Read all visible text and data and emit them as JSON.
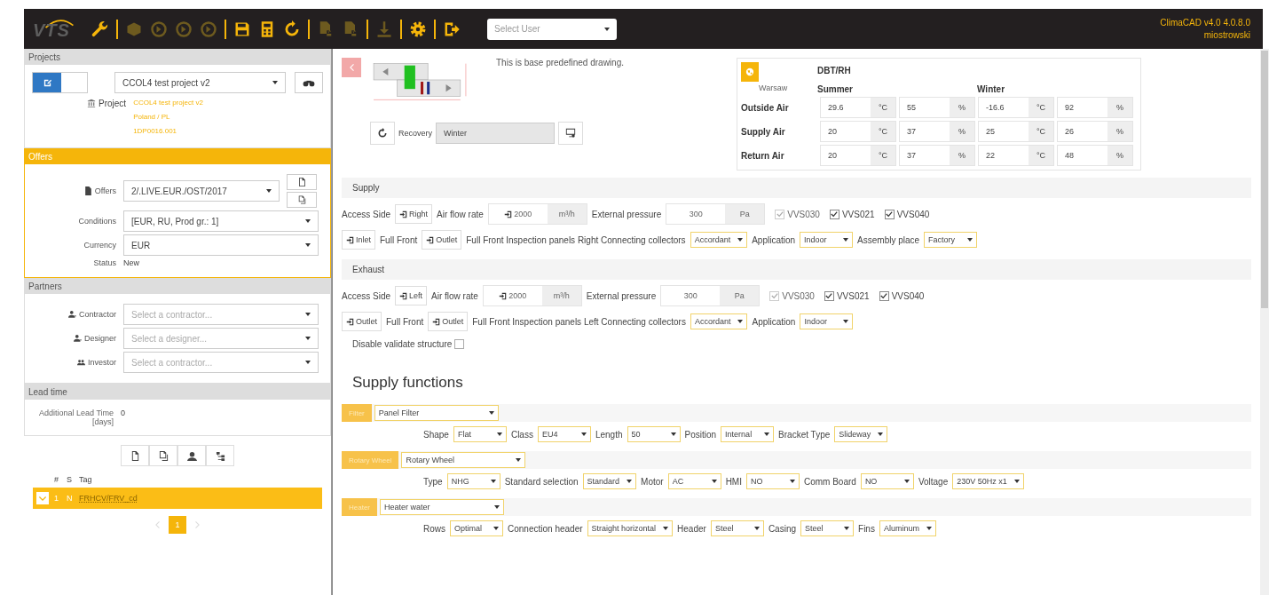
{
  "topbar": {
    "logo": "VTS",
    "toolbar": [
      [
        {
          "kind": "wrench",
          "disabled": false
        }
      ],
      [
        {
          "kind": "cube",
          "disabled": true
        },
        {
          "kind": "circle-arrow",
          "disabled": true
        },
        {
          "kind": "circle-arrow",
          "disabled": true
        },
        {
          "kind": "circle-arrow",
          "disabled": true
        }
      ],
      [
        {
          "kind": "save",
          "disabled": false
        },
        {
          "kind": "calculator",
          "disabled": false
        },
        {
          "kind": "refresh",
          "disabled": false
        }
      ],
      [
        {
          "kind": "document",
          "disabled": true
        },
        {
          "kind": "document",
          "disabled": true
        }
      ],
      [
        {
          "kind": "download",
          "disabled": true
        }
      ],
      [
        {
          "kind": "gear",
          "disabled": false
        }
      ],
      [
        {
          "kind": "logout",
          "disabled": false
        }
      ]
    ],
    "user_select": {
      "placeholder": "Select User"
    },
    "app_version": "ClimaCAD v4.0 4.0.8.0",
    "username": "miostrowski"
  },
  "sidebar": {
    "projects": {
      "header": "Projects",
      "selected": false,
      "edit_on": true,
      "project": "CCOL4 test project v2",
      "info_label": "Project",
      "info_lines": [
        "CCOL4 test project v2",
        "Poland / PL",
        "1DP0016.001"
      ]
    },
    "offers": {
      "header": "Offers",
      "selected": true,
      "offer_label": "Offers",
      "offer": "2/.LIVE.EUR./OST/2017",
      "conditions_label": "Conditions",
      "conditions": "[EUR, RU, Prod gr.: 1]",
      "currency_label": "Currency",
      "currency": "EUR",
      "status_label": "Status",
      "status": "New"
    },
    "partners": {
      "header": "Partners",
      "selected": false,
      "fields": [
        {
          "kind": "person",
          "label": "Contractor",
          "placeholder": "Select a contractor..."
        },
        {
          "kind": "person",
          "label": "Designer",
          "placeholder": "Select a designer..."
        },
        {
          "kind": "group",
          "label": "Investor",
          "placeholder": "Select a contractor..."
        }
      ]
    },
    "lead_time": {
      "header": "Lead time",
      "selected": false,
      "label": "Additional Lead Time",
      "unit": "[days]",
      "value": "0"
    },
    "unit_actions": [
      {
        "kind": "new"
      },
      {
        "kind": "copy"
      },
      {
        "kind": "user"
      },
      {
        "kind": "tree"
      }
    ],
    "units": {
      "columns": [
        "#",
        "S",
        "Tag"
      ],
      "rows": [
        {
          "number": "1",
          "status": "N",
          "tag": "FRHCV/FRV_cd",
          "selected": true
        }
      ]
    },
    "pages": [
      {
        "label": "1",
        "selected": true
      }
    ]
  },
  "main": {
    "drawing_note": "This is base predefined drawing.",
    "recovery": {
      "label": "Recovery",
      "value": "Winter"
    },
    "climate": {
      "title": "DBT/RH",
      "location": "Warsaw",
      "seasons": [
        "Summer",
        "Winter"
      ],
      "rows": [
        {
          "name": "Outside Air",
          "cells": [
            {
              "value": "29.6",
              "unit": "°C"
            },
            {
              "value": "55",
              "unit": "%"
            },
            {
              "value": "-16.6",
              "unit": "°C"
            },
            {
              "value": "92",
              "unit": "%"
            }
          ]
        },
        {
          "name": "Supply Air",
          "cells": [
            {
              "value": "20",
              "unit": "°C"
            },
            {
              "value": "37",
              "unit": "%"
            },
            {
              "value": "25",
              "unit": "°C"
            },
            {
              "value": "26",
              "unit": "%"
            }
          ]
        },
        {
          "name": "Return Air",
          "cells": [
            {
              "value": "20",
              "unit": "°C"
            },
            {
              "value": "37",
              "unit": "%"
            },
            {
              "value": "22",
              "unit": "°C"
            },
            {
              "value": "48",
              "unit": "%"
            }
          ]
        }
      ]
    },
    "sections": [
      {
        "title": "Supply",
        "flow_row": [
          {
            "kind": "label",
            "text": "Access Side"
          },
          {
            "kind": "button",
            "text": "Right"
          },
          {
            "kind": "label",
            "text": "Air flow rate"
          },
          {
            "kind": "field",
            "value": "2000",
            "unit": "m³/h",
            "icon": true
          },
          {
            "kind": "label",
            "text": "External pressure"
          },
          {
            "kind": "field",
            "value": "300",
            "unit": "Pa",
            "icon": false
          },
          {
            "kind": "check",
            "label": "VVS030",
            "checked": true,
            "disabled": true
          },
          {
            "kind": "check",
            "label": "VVS021",
            "checked": true,
            "disabled": false
          },
          {
            "kind": "check",
            "label": "VVS040",
            "checked": true,
            "disabled": false
          }
        ],
        "options_row": [
          {
            "kind": "button",
            "text": "Inlet"
          },
          {
            "kind": "label",
            "text": "Full Front"
          },
          {
            "kind": "button",
            "text": "Outlet"
          },
          {
            "kind": "label",
            "text": "Full Front Inspection panels Right Connecting collectors"
          },
          {
            "kind": "select",
            "value": "Accordant"
          },
          {
            "kind": "label",
            "text": "Application"
          },
          {
            "kind": "select",
            "value": "Indoor"
          },
          {
            "kind": "label",
            "text": "Assembly place"
          },
          {
            "kind": "select",
            "value": "Factory"
          }
        ]
      },
      {
        "title": "Exhaust",
        "flow_row": [
          {
            "kind": "label",
            "text": "Access Side"
          },
          {
            "kind": "button",
            "text": "Left"
          },
          {
            "kind": "label",
            "text": "Air flow rate"
          },
          {
            "kind": "field",
            "value": "2000",
            "unit": "m³/h",
            "icon": true
          },
          {
            "kind": "label",
            "text": "External pressure"
          },
          {
            "kind": "field",
            "value": "300",
            "unit": "Pa",
            "icon": false
          },
          {
            "kind": "check",
            "label": "VVS030",
            "checked": true,
            "disabled": true
          },
          {
            "kind": "check",
            "label": "VVS021",
            "checked": true,
            "disabled": false
          },
          {
            "kind": "check",
            "label": "VVS040",
            "checked": true,
            "disabled": false
          }
        ],
        "options_row": [
          {
            "kind": "button",
            "text": "Outlet"
          },
          {
            "kind": "label",
            "text": "Full Front"
          },
          {
            "kind": "button",
            "text": "Outlet"
          },
          {
            "kind": "label",
            "text": "Full Front Inspection panels Left Connecting collectors"
          },
          {
            "kind": "select",
            "value": "Accordant"
          },
          {
            "kind": "label",
            "text": "Application"
          },
          {
            "kind": "select",
            "value": "Indoor"
          }
        ]
      }
    ],
    "validate": {
      "label": "Disable validate structure",
      "checked": false
    },
    "functions_title": "Supply functions",
    "functions": [
      {
        "tag": "Filter",
        "type": "Panel Filter",
        "params": [
          {
            "label": "Shape",
            "value": "Flat"
          },
          {
            "label": "Class",
            "value": "EU4"
          },
          {
            "label": "Length",
            "value": "50"
          },
          {
            "label": "Position",
            "value": "Internal"
          },
          {
            "label": "Bracket Type",
            "value": "Slideway"
          }
        ]
      },
      {
        "tag": "Rotary Wheel",
        "type": "Rotary Wheel",
        "params": [
          {
            "label": "Type",
            "value": "NHG"
          },
          {
            "label": "Standard selection",
            "value": "Standard"
          },
          {
            "label": "Motor",
            "value": "AC"
          },
          {
            "label": "HMI",
            "value": "NO"
          },
          {
            "label": "Comm Board",
            "value": "NO"
          },
          {
            "label": "Voltage",
            "value": "230V 50Hz x1"
          }
        ]
      },
      {
        "tag": "Heater",
        "type": "Heater water",
        "params": [
          {
            "label": "Rows",
            "value": "Optimal"
          },
          {
            "label": "Connection header",
            "value": "Straight horizontal"
          },
          {
            "label": "Header",
            "value": "Steel"
          },
          {
            "label": "Casing",
            "value": "Steel"
          },
          {
            "label": "Fins",
            "value": "Aluminum"
          }
        ]
      }
    ]
  }
}
